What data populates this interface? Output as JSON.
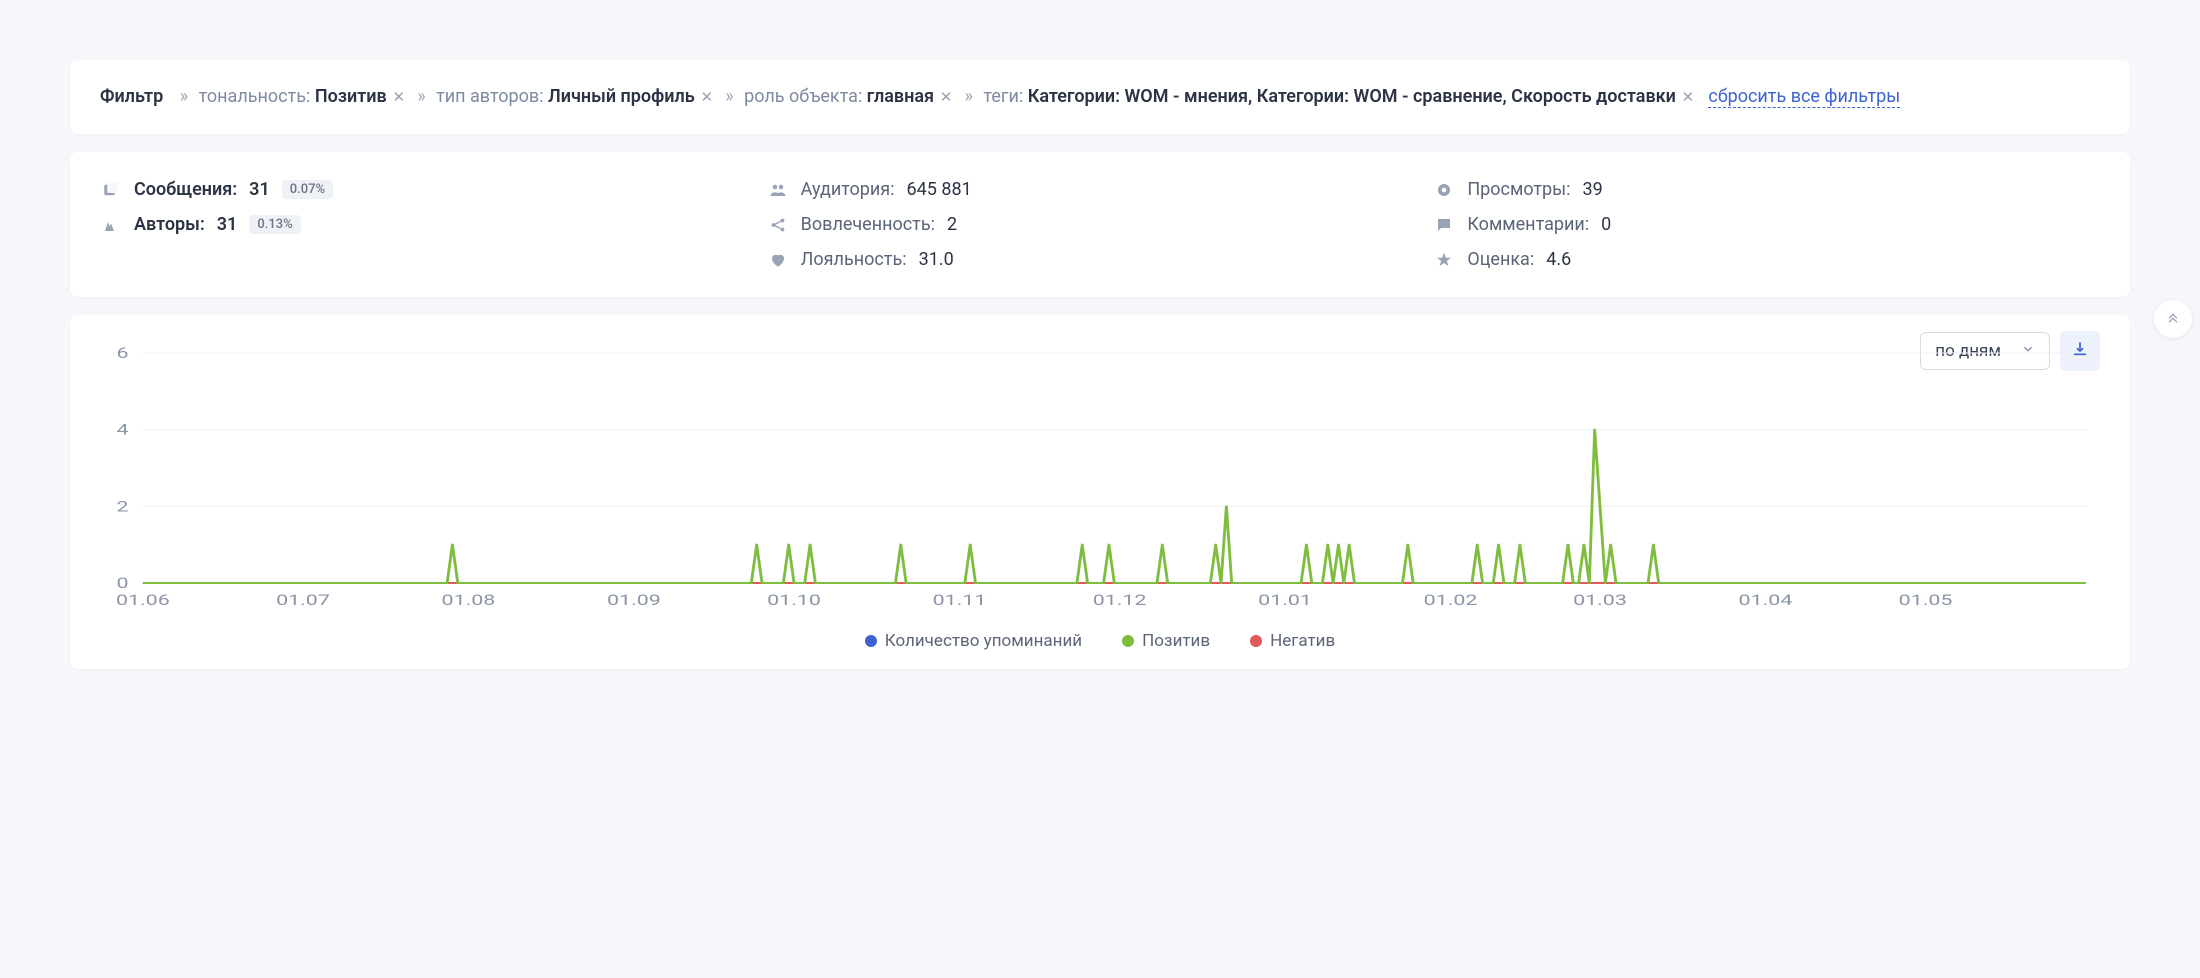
{
  "filter": {
    "title": "Фильтр",
    "sep": "»",
    "reset": "сбросить все фильтры",
    "items": [
      {
        "label": "тональность:",
        "value": "Позитив"
      },
      {
        "label": "тип авторов:",
        "value": "Личный профиль"
      },
      {
        "label": "роль объекта:",
        "value": "главная"
      },
      {
        "label": "теги:",
        "value": "Категории: WOM - мнения, Категории: WOM - сравнение, Скорость доставки"
      }
    ]
  },
  "stats": {
    "messages": {
      "label": "Сообщения:",
      "value": "31",
      "badge": "0.07%"
    },
    "authors": {
      "label": "Авторы:",
      "value": "31",
      "badge": "0.13%"
    },
    "audience": {
      "label": "Аудитория:",
      "value": "645 881"
    },
    "engagement": {
      "label": "Вовлеченность:",
      "value": "2"
    },
    "loyalty": {
      "label": "Лояльность:",
      "value": "31.0"
    },
    "views": {
      "label": "Просмотры:",
      "value": "39"
    },
    "comments": {
      "label": "Комментарии:",
      "value": "0"
    },
    "rating": {
      "label": "Оценка:",
      "value": "4.6"
    }
  },
  "dropdown": {
    "selected": "по дням"
  },
  "chart_data": {
    "type": "line",
    "title": "",
    "xlabel": "",
    "ylabel": "",
    "ylim": [
      0,
      6
    ],
    "yticks": [
      0,
      2,
      4,
      6
    ],
    "x_month_ticks": [
      "01.06",
      "01.07",
      "01.08",
      "01.09",
      "01.10",
      "01.11",
      "01.12",
      "01.01",
      "01.02",
      "01.03",
      "01.04",
      "01.05"
    ],
    "months_days": [
      30,
      31,
      31,
      30,
      31,
      30,
      31,
      31,
      28,
      31,
      30,
      31
    ],
    "series": [
      {
        "name": "Количество упоминаний",
        "color": "#3d63d3"
      },
      {
        "name": "Позитив",
        "color": "#7fbd3f"
      },
      {
        "name": "Негатив",
        "color": "#e05a5a"
      }
    ],
    "negative_constant": 0,
    "mentions_same_as_positive": true,
    "positive_spikes": [
      {
        "month": 1,
        "day": 29,
        "value": 1
      },
      {
        "month": 3,
        "day": 24,
        "value": 1
      },
      {
        "month": 3,
        "day": 30,
        "value": 1
      },
      {
        "month": 4,
        "day": 4,
        "value": 1
      },
      {
        "month": 4,
        "day": 21,
        "value": 1
      },
      {
        "month": 5,
        "day": 3,
        "value": 1
      },
      {
        "month": 5,
        "day": 24,
        "value": 1
      },
      {
        "month": 5,
        "day": 29,
        "value": 1
      },
      {
        "month": 6,
        "day": 9,
        "value": 1
      },
      {
        "month": 6,
        "day": 19,
        "value": 1
      },
      {
        "month": 6,
        "day": 21,
        "value": 2
      },
      {
        "month": 7,
        "day": 5,
        "value": 1
      },
      {
        "month": 7,
        "day": 9,
        "value": 1
      },
      {
        "month": 7,
        "day": 11,
        "value": 1
      },
      {
        "month": 7,
        "day": 13,
        "value": 1
      },
      {
        "month": 7,
        "day": 24,
        "value": 1
      },
      {
        "month": 8,
        "day": 6,
        "value": 1
      },
      {
        "month": 8,
        "day": 10,
        "value": 1
      },
      {
        "month": 8,
        "day": 14,
        "value": 1
      },
      {
        "month": 8,
        "day": 23,
        "value": 1
      },
      {
        "month": 8,
        "day": 26,
        "value": 1
      },
      {
        "month": 8,
        "day": 28,
        "value": 4
      },
      {
        "month": 9,
        "day": 1,
        "value": 2
      },
      {
        "month": 9,
        "day": 3,
        "value": 1
      },
      {
        "month": 9,
        "day": 11,
        "value": 1
      }
    ]
  }
}
